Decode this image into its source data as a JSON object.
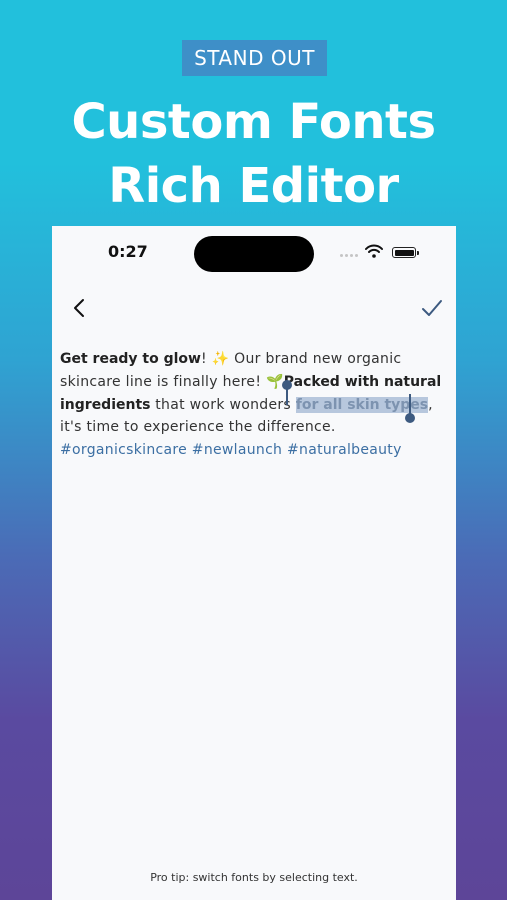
{
  "banner": {
    "badge": "STAND OUT",
    "headline_line1": "Custom Fonts",
    "headline_line2": "Rich Editor"
  },
  "status_bar": {
    "time": "0:27"
  },
  "nav": {
    "back_icon": "chevron-left-icon",
    "done_icon": "checkmark-icon"
  },
  "editor": {
    "intro_bold": "Get ready to glow",
    "exclaim": "!",
    "sparkle": "✨",
    "text_1": "Our brand new organic skincare line is finally here!",
    "leaf": "🌱",
    "bold_2": "Packed with natural ingredients",
    "text_2": "that work wonders",
    "selected": "for all skin types",
    "text_3": ", it's time to experience the difference.",
    "hashtags": "#organicskincare #newlaunch #naturalbeauty"
  },
  "footer": {
    "tip": "Pro tip: switch fonts by selecting text."
  },
  "colors": {
    "background_top": "#22c0dc",
    "background_bottom": "#5d4598",
    "badge": "#3e8fc8",
    "hashtag": "#3c6fa3",
    "selection": "#b7c7dd",
    "accent": "#3d5a80"
  }
}
